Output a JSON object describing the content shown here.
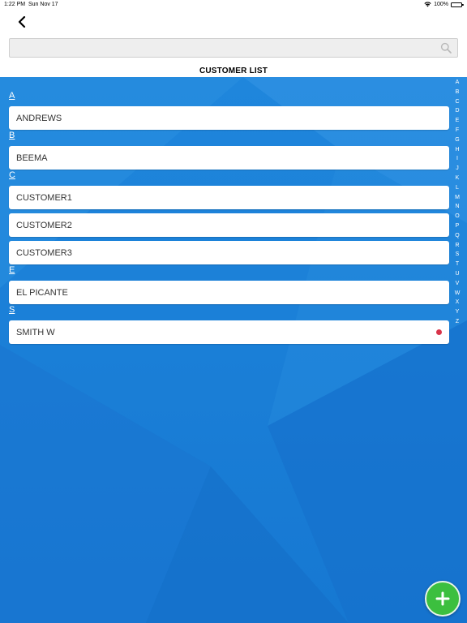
{
  "status_bar": {
    "time": "1:22 PM",
    "date": "Sun Nov 17",
    "battery": "100%"
  },
  "search": {
    "placeholder": ""
  },
  "page_title": "CUSTOMER LIST",
  "sections": [
    {
      "letter": "A",
      "items": [
        {
          "name": "ANDREWS"
        }
      ]
    },
    {
      "letter": "B",
      "items": [
        {
          "name": "BEEMA"
        }
      ]
    },
    {
      "letter": "C",
      "items": [
        {
          "name": "CUSTOMER1"
        },
        {
          "name": "CUSTOMER2"
        },
        {
          "name": "CUSTOMER3"
        }
      ]
    },
    {
      "letter": "E",
      "items": [
        {
          "name": "EL PICANTE"
        }
      ]
    },
    {
      "letter": "S",
      "items": [
        {
          "name": "SMITH W",
          "flag": "red-dot"
        }
      ]
    }
  ],
  "alphabet_index": [
    "A",
    "B",
    "C",
    "D",
    "E",
    "F",
    "G",
    "H",
    "I",
    "J",
    "K",
    "L",
    "M",
    "N",
    "O",
    "P",
    "Q",
    "R",
    "S",
    "T",
    "U",
    "V",
    "W",
    "X",
    "Y",
    "Z"
  ],
  "icons": {
    "back": "chevron-left-icon",
    "search": "search-icon",
    "add": "plus-icon",
    "wifi": "wifi-icon",
    "battery": "battery-icon"
  },
  "colors": {
    "background": "#1a7fd6",
    "fab": "#3cbf3f",
    "flag_dot": "#d8344a"
  }
}
